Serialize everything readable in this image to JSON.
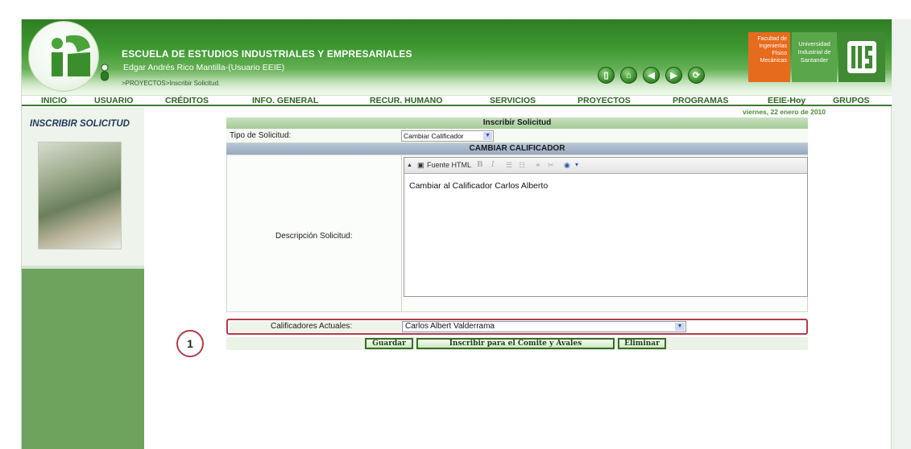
{
  "header": {
    "title": "ESCUELA DE ESTUDIOS INDUSTRIALES Y EMPRESARIALES",
    "user": "Edgar Andrés Rico Mantilla-(Usuario EEIE)",
    "breadcrumb": ">PROYECTOS>Inscribir Solicitud.",
    "nav_icons": [
      "book-icon",
      "home-icon",
      "back-arrow-icon",
      "forward-arrow-icon",
      "refresh-icon"
    ],
    "badge_faculty": "Facultad de Ingenierías Físico Mecánicas",
    "badge_university": "Universidad Industrial de Santander"
  },
  "menu": {
    "items": [
      "INICIO",
      "USUARIO",
      "CRÉDITOS",
      "INFO. GENERAL",
      "RECUR. HUMANO",
      "SERVICIOS",
      "PROYECTOS",
      "PROGRAMAS",
      "EEIE-Hoy",
      "GRUPOS"
    ]
  },
  "date": "viernes, 22 enero de 2010",
  "sidebar": {
    "title": "INSCRIBIR SOLICITUD"
  },
  "form": {
    "header": "Inscribir Solicitud",
    "tipo_label": "Tipo de Solicitud:",
    "tipo_value": "Cambiar Calificador",
    "section_header": "CAMBIAR CALIFICADOR",
    "desc_label": "Descripción Solicitud:",
    "editor_source_label": "Fuente HTML",
    "editor_text": "Cambiar al Calificador Carlos Alberto",
    "calif_label": "Calificadores Actuales:",
    "calif_value": "Carlos Albert Valderrama",
    "annotation": "1"
  },
  "buttons": {
    "save": "Guardar",
    "enroll": "Inscribir para el Comite y Avales",
    "delete": "Eliminar"
  },
  "colors": {
    "header_green": "#3f9a32",
    "accent_red": "#b23a48",
    "faculty_orange": "#e76b1d"
  }
}
